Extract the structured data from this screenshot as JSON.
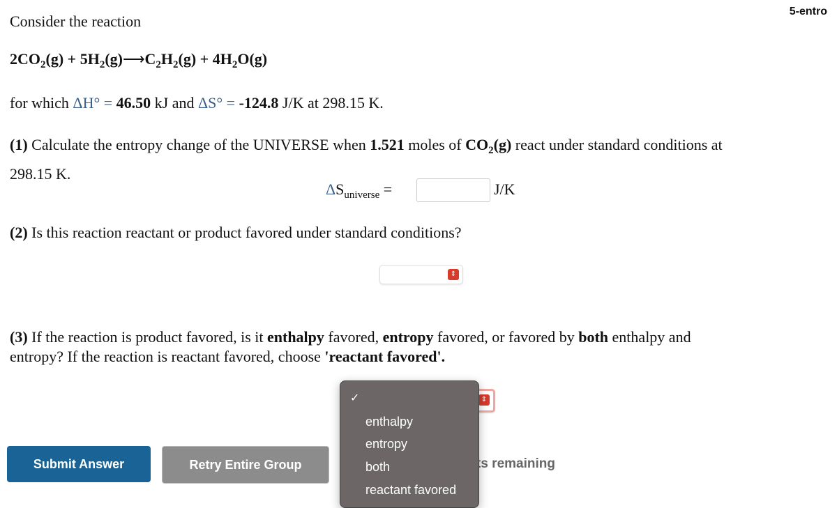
{
  "header": {
    "label": "5-entro"
  },
  "intro": "Consider the reaction",
  "reaction": {
    "r1": "2CO",
    "r1s": "2",
    "r1p": "(g) + 5H",
    "r2s": "2",
    "r2p": "(g)",
    "arrow": "⟶",
    "p1": "C",
    "p1s": "2",
    "p1m": "H",
    "p1s2": "2",
    "p1p": "(g) + 4H",
    "p2s": "2",
    "p2p": "O(g)"
  },
  "thermo": {
    "pre": "for which ",
    "dH": "ΔH° = ",
    "dHv": "46.50",
    "mid": " kJ and ",
    "dS": "ΔS° = ",
    "dSv": "-124.8",
    "post": " J/K at 298.15 K."
  },
  "q1": {
    "num": "(1)",
    "text1": " Calculate the entropy change of the UNIVERSE when ",
    "moles": "1.521",
    "text2": " moles of ",
    "species": "CO",
    "species_sub": "2",
    "species_p": "(g)",
    "text3": " react under standard conditions at",
    "text4": "298.15 K.",
    "label": "ΔS",
    "label_sub": "universe",
    "eq": " =",
    "value": "",
    "unit": "J/K"
  },
  "q2": {
    "num": "(2)",
    "text": " Is this reaction reactant or product favored under standard conditions?",
    "selected": ""
  },
  "q3": {
    "num": "(3)",
    "t1": " If the reaction is product favored, is it ",
    "b1": "enthalpy",
    "t2": " favored, ",
    "b2": "entropy",
    "t3": " favored, or favored by ",
    "b3": "both",
    "t4": " enthalpy and",
    "t5": "entropy? If the reaction is reactant favored, choose ",
    "b4": "'reactant favored'.",
    "selected": "",
    "options": [
      "enthalpy",
      "entropy",
      "both",
      "reactant favored"
    ]
  },
  "buttons": {
    "submit": "Submit Answer",
    "retry": "Retry Entire Group",
    "attempts": "ts remaining"
  },
  "colors": {
    "submit": "#1a6396",
    "retry": "#8c8c8c",
    "select_accent": "#d83a2b"
  }
}
